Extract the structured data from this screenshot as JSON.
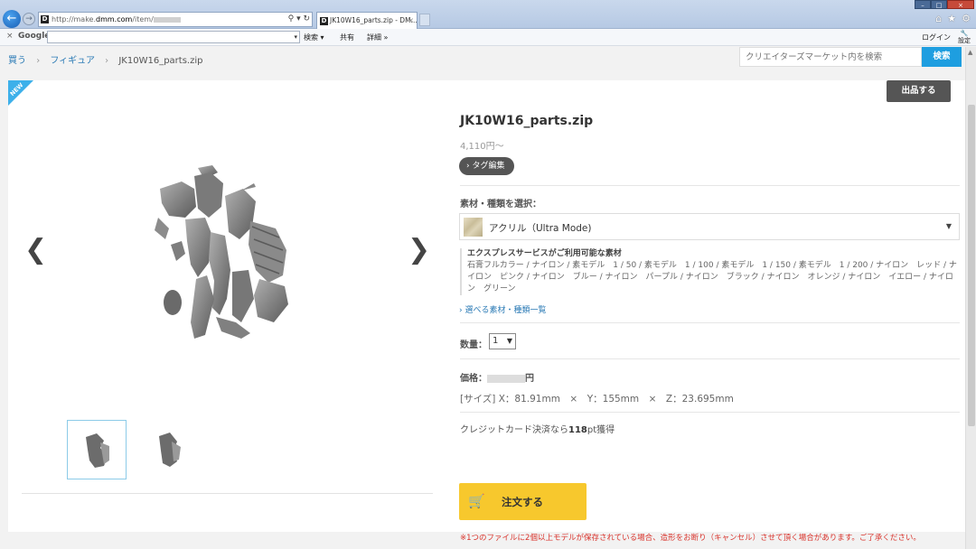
{
  "browser": {
    "url_prefix": "http://make.",
    "url_domain": "dmm.com",
    "url_path": "/item/",
    "tab_title": "JK10W16_parts.zip - DM...",
    "google_label": "Google",
    "search_label": "検索",
    "share_label": "共有",
    "more_label": "詳細 »",
    "login_label": "ログイン",
    "settings_label": "設定"
  },
  "breadcrumb": {
    "items": [
      "買う",
      "フィギュア"
    ],
    "current": "JK10W16_parts.zip"
  },
  "search": {
    "placeholder": "クリエイターズマーケット内を検索",
    "button": "検索"
  },
  "gallery": {
    "badge": "NEW"
  },
  "product": {
    "sell_button": "出品する",
    "title": "JK10W16_parts.zip",
    "price_from": "4,110円～",
    "tag_button": "タグ編集",
    "material_label": "素材・種類を選択：",
    "material_selected": "アクリル（Ultra Mode)",
    "express_title": "エクスプレスサービスがご利用可能な素材",
    "express_list": "石膏フルカラー / ナイロン / 素モデル　1 / 50 / 素モデル　1 / 100 / 素モデル　1 / 150 / 素モデル　1 / 200 / ナイロン　レッド / ナイロン　ピンク / ナイロン　ブルー / ナイロン　パープル / ナイロン　ブラック / ナイロン　オレンジ / ナイロン　イエロー / ナイロン　グリーン",
    "material_list_link": "選べる素材・種類一覧",
    "quantity_label": "数量：",
    "quantity_value": "1",
    "price_label": "価格：",
    "price_unit": "円",
    "size_info": "[サイズ] X：81.91mm　×　Y：155mm　×　Z：23.695mm",
    "credit_prefix": "クレジットカード決済なら",
    "credit_points": "118",
    "credit_suffix": "pt獲得",
    "order_button": "注文する",
    "warning": "※1つのファイルに2個以上モデルが保存されている場合、造形をお断り（キャンセル）させて頂く場合があります。ご了承ください。"
  }
}
